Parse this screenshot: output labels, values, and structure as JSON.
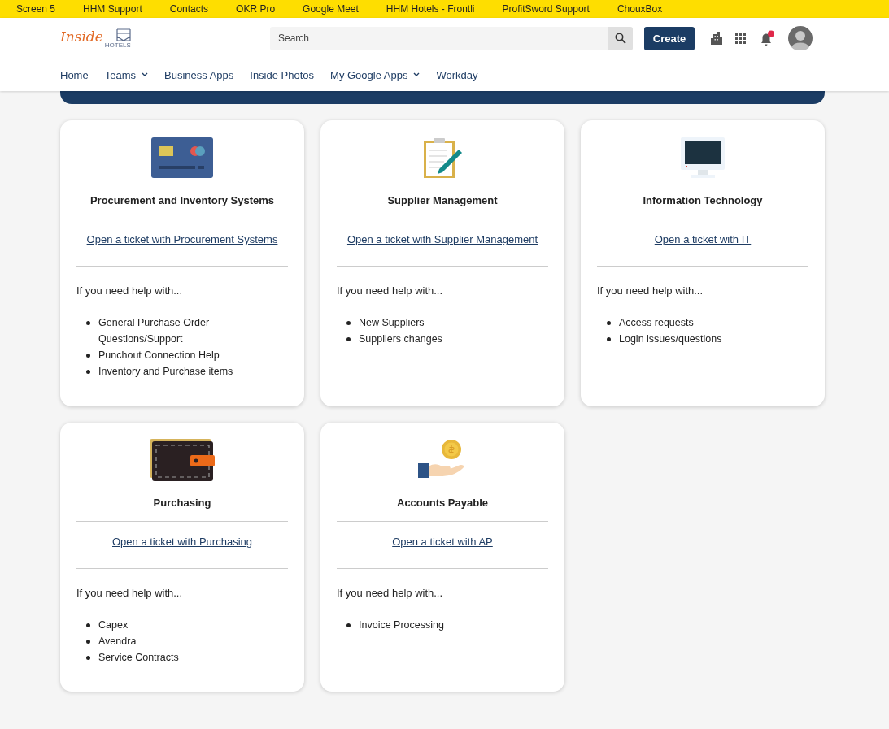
{
  "bookmarks_bar": [
    "Screen 5",
    "HHM Support",
    "Contacts",
    "OKR Pro",
    "Google Meet",
    "HHM Hotels - Frontli",
    "ProfitSword Support",
    "ChouxBox"
  ],
  "header": {
    "logo": "Inside",
    "logo_sub": "HOTELS",
    "search": {
      "placeholder": "Search"
    },
    "create_button": "Create",
    "notification_unread": true
  },
  "nav": [
    {
      "label": "Home",
      "dropdown": false
    },
    {
      "label": "Teams",
      "dropdown": true
    },
    {
      "label": "Business Apps",
      "dropdown": false
    },
    {
      "label": "Inside Photos",
      "dropdown": false
    },
    {
      "label": "My Google Apps",
      "dropdown": true
    },
    {
      "label": "Workday",
      "dropdown": false
    }
  ],
  "cards": [
    {
      "kind": "credit-card",
      "title": "Procurement and Inventory Systems",
      "link": "Open a ticket with Procurement Systems",
      "intro": "If you need help with...",
      "items": [
        "General Purchase Order Questions/Support",
        "Punchout Connection Help",
        "Inventory and Purchase items"
      ]
    },
    {
      "kind": "clipboard",
      "title": "Supplier Management",
      "link": "Open a ticket with Supplier Management",
      "intro": "If you need help with...",
      "items": [
        "New Suppliers",
        "Suppliers changes"
      ]
    },
    {
      "kind": "monitor",
      "title": "Information Technology",
      "link": "Open a ticket with IT",
      "intro": "If you need help with...",
      "items": [
        "Access requests",
        "Login issues/questions"
      ]
    },
    {
      "kind": "wallet",
      "title": "Purchasing",
      "link": "Open a ticket with Purchasing",
      "intro": "If you need help with...",
      "items": [
        "Capex",
        "Avendra",
        "Service Contracts"
      ]
    },
    {
      "kind": "coin-hand",
      "title": "Accounts Payable",
      "link": "Open a ticket with AP",
      "intro": "If you need help with...",
      "items": [
        "Invoice Processing"
      ]
    }
  ]
}
